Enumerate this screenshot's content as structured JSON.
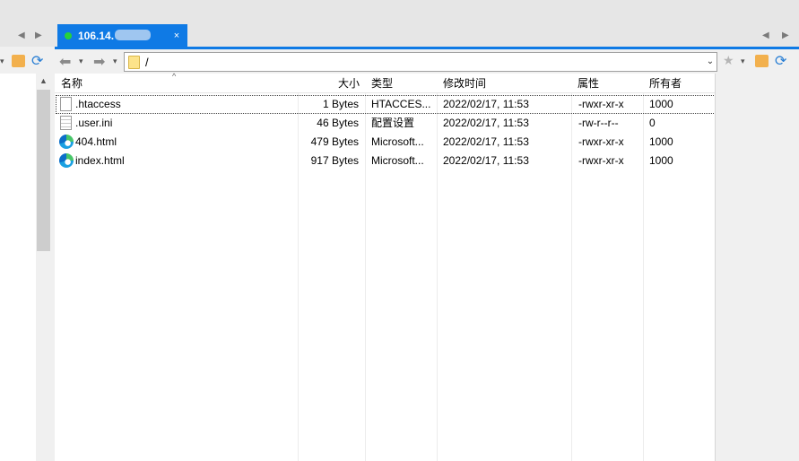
{
  "left_pane": {
    "nav": {
      "back": "◀",
      "forward": "▶"
    },
    "scroll_up": "▲"
  },
  "tab": {
    "title": "106.14.",
    "close": "×",
    "status_color": "#27d23a",
    "accent": "#0f7ae5"
  },
  "nav": {
    "back": "◀",
    "forward": "▶",
    "dropdown": "▾",
    "bookmark": "★",
    "home": "⌂",
    "refresh": "⟳"
  },
  "path": {
    "value": "/"
  },
  "columns": [
    "名称",
    "大小",
    "类型",
    "修改时间",
    "属性",
    "所有者"
  ],
  "files": [
    {
      "name": ".htaccess",
      "size": "1 Bytes",
      "type": "HTACCES...",
      "modified": "2022/02/17, 11:53",
      "perms": "-rwxr-xr-x",
      "owner": "1000",
      "icon": "file-icon"
    },
    {
      "name": ".user.ini",
      "size": "46 Bytes",
      "type": "配置设置",
      "modified": "2022/02/17, 11:53",
      "perms": "-rw-r--r--",
      "owner": "0",
      "icon": "config-file-icon"
    },
    {
      "name": "404.html",
      "size": "479 Bytes",
      "type": "Microsoft...",
      "modified": "2022/02/17, 11:53",
      "perms": "-rwxr-xr-x",
      "owner": "1000",
      "icon": "edge-browser-icon"
    },
    {
      "name": "index.html",
      "size": "917 Bytes",
      "type": "Microsoft...",
      "modified": "2022/02/17, 11:53",
      "perms": "-rwxr-xr-x",
      "owner": "1000",
      "icon": "edge-browser-icon"
    }
  ]
}
